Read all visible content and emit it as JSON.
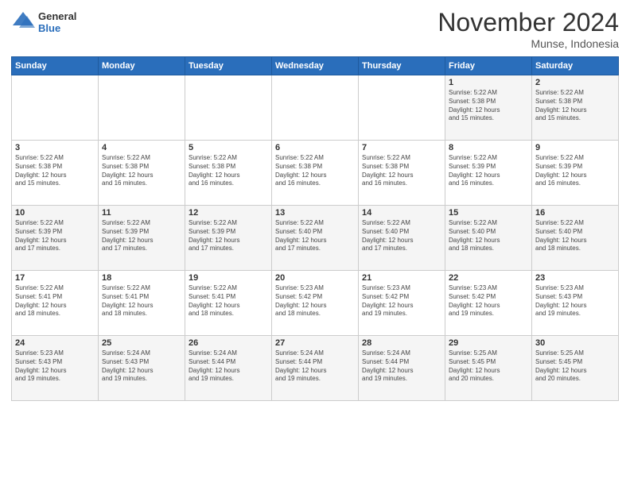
{
  "logo": {
    "general": "General",
    "blue": "Blue"
  },
  "title": "November 2024",
  "location": "Munse, Indonesia",
  "days_of_week": [
    "Sunday",
    "Monday",
    "Tuesday",
    "Wednesday",
    "Thursday",
    "Friday",
    "Saturday"
  ],
  "weeks": [
    [
      {
        "day": "",
        "info": ""
      },
      {
        "day": "",
        "info": ""
      },
      {
        "day": "",
        "info": ""
      },
      {
        "day": "",
        "info": ""
      },
      {
        "day": "",
        "info": ""
      },
      {
        "day": "1",
        "info": "Sunrise: 5:22 AM\nSunset: 5:38 PM\nDaylight: 12 hours\nand 15 minutes."
      },
      {
        "day": "2",
        "info": "Sunrise: 5:22 AM\nSunset: 5:38 PM\nDaylight: 12 hours\nand 15 minutes."
      }
    ],
    [
      {
        "day": "3",
        "info": "Sunrise: 5:22 AM\nSunset: 5:38 PM\nDaylight: 12 hours\nand 15 minutes."
      },
      {
        "day": "4",
        "info": "Sunrise: 5:22 AM\nSunset: 5:38 PM\nDaylight: 12 hours\nand 16 minutes."
      },
      {
        "day": "5",
        "info": "Sunrise: 5:22 AM\nSunset: 5:38 PM\nDaylight: 12 hours\nand 16 minutes."
      },
      {
        "day": "6",
        "info": "Sunrise: 5:22 AM\nSunset: 5:38 PM\nDaylight: 12 hours\nand 16 minutes."
      },
      {
        "day": "7",
        "info": "Sunrise: 5:22 AM\nSunset: 5:38 PM\nDaylight: 12 hours\nand 16 minutes."
      },
      {
        "day": "8",
        "info": "Sunrise: 5:22 AM\nSunset: 5:39 PM\nDaylight: 12 hours\nand 16 minutes."
      },
      {
        "day": "9",
        "info": "Sunrise: 5:22 AM\nSunset: 5:39 PM\nDaylight: 12 hours\nand 16 minutes."
      }
    ],
    [
      {
        "day": "10",
        "info": "Sunrise: 5:22 AM\nSunset: 5:39 PM\nDaylight: 12 hours\nand 17 minutes."
      },
      {
        "day": "11",
        "info": "Sunrise: 5:22 AM\nSunset: 5:39 PM\nDaylight: 12 hours\nand 17 minutes."
      },
      {
        "day": "12",
        "info": "Sunrise: 5:22 AM\nSunset: 5:39 PM\nDaylight: 12 hours\nand 17 minutes."
      },
      {
        "day": "13",
        "info": "Sunrise: 5:22 AM\nSunset: 5:40 PM\nDaylight: 12 hours\nand 17 minutes."
      },
      {
        "day": "14",
        "info": "Sunrise: 5:22 AM\nSunset: 5:40 PM\nDaylight: 12 hours\nand 17 minutes."
      },
      {
        "day": "15",
        "info": "Sunrise: 5:22 AM\nSunset: 5:40 PM\nDaylight: 12 hours\nand 18 minutes."
      },
      {
        "day": "16",
        "info": "Sunrise: 5:22 AM\nSunset: 5:40 PM\nDaylight: 12 hours\nand 18 minutes."
      }
    ],
    [
      {
        "day": "17",
        "info": "Sunrise: 5:22 AM\nSunset: 5:41 PM\nDaylight: 12 hours\nand 18 minutes."
      },
      {
        "day": "18",
        "info": "Sunrise: 5:22 AM\nSunset: 5:41 PM\nDaylight: 12 hours\nand 18 minutes."
      },
      {
        "day": "19",
        "info": "Sunrise: 5:22 AM\nSunset: 5:41 PM\nDaylight: 12 hours\nand 18 minutes."
      },
      {
        "day": "20",
        "info": "Sunrise: 5:23 AM\nSunset: 5:42 PM\nDaylight: 12 hours\nand 18 minutes."
      },
      {
        "day": "21",
        "info": "Sunrise: 5:23 AM\nSunset: 5:42 PM\nDaylight: 12 hours\nand 19 minutes."
      },
      {
        "day": "22",
        "info": "Sunrise: 5:23 AM\nSunset: 5:42 PM\nDaylight: 12 hours\nand 19 minutes."
      },
      {
        "day": "23",
        "info": "Sunrise: 5:23 AM\nSunset: 5:43 PM\nDaylight: 12 hours\nand 19 minutes."
      }
    ],
    [
      {
        "day": "24",
        "info": "Sunrise: 5:23 AM\nSunset: 5:43 PM\nDaylight: 12 hours\nand 19 minutes."
      },
      {
        "day": "25",
        "info": "Sunrise: 5:24 AM\nSunset: 5:43 PM\nDaylight: 12 hours\nand 19 minutes."
      },
      {
        "day": "26",
        "info": "Sunrise: 5:24 AM\nSunset: 5:44 PM\nDaylight: 12 hours\nand 19 minutes."
      },
      {
        "day": "27",
        "info": "Sunrise: 5:24 AM\nSunset: 5:44 PM\nDaylight: 12 hours\nand 19 minutes."
      },
      {
        "day": "28",
        "info": "Sunrise: 5:24 AM\nSunset: 5:44 PM\nDaylight: 12 hours\nand 19 minutes."
      },
      {
        "day": "29",
        "info": "Sunrise: 5:25 AM\nSunset: 5:45 PM\nDaylight: 12 hours\nand 20 minutes."
      },
      {
        "day": "30",
        "info": "Sunrise: 5:25 AM\nSunset: 5:45 PM\nDaylight: 12 hours\nand 20 minutes."
      }
    ]
  ]
}
